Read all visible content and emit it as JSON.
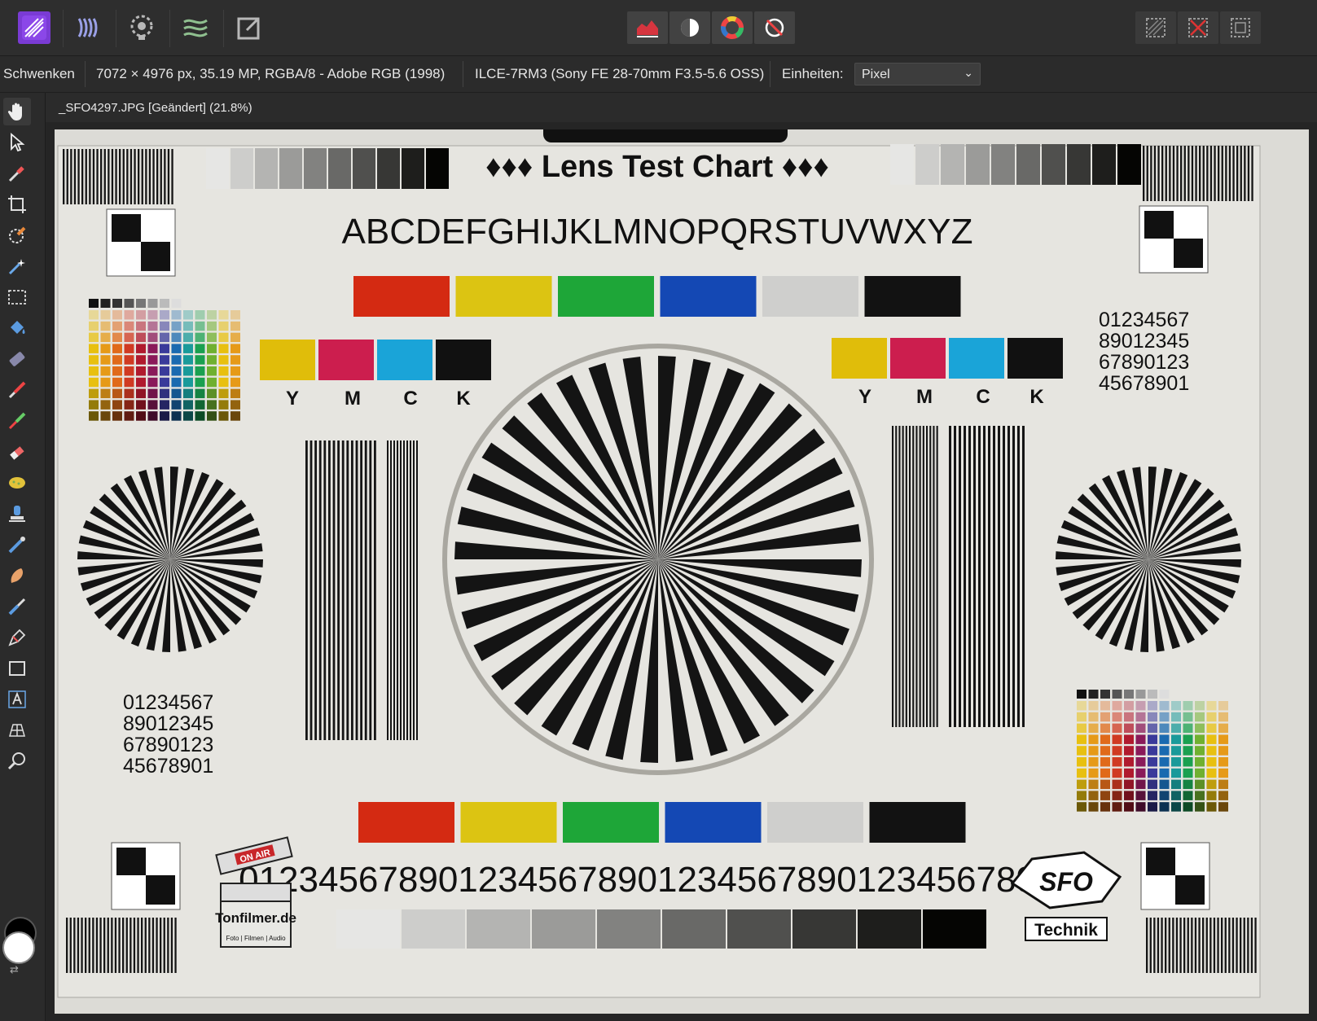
{
  "toolbar": {
    "personas": [
      "Photo Persona",
      "Liquify Persona",
      "Develop Persona",
      "Tone Mapping Persona",
      "Export Persona"
    ],
    "studio_buttons": [
      "histogram-icon",
      "adjustment-icon",
      "color-wheel-icon",
      "navigator-icon"
    ],
    "view_buttons": [
      "selection-mask-icon",
      "deselect-icon",
      "marquee-icon"
    ]
  },
  "context": {
    "tool_name": "Schwenken",
    "image_info": "7072 × 4976 px, 35.19 MP, RGBA/8 - Adobe RGB (1998)",
    "camera_info": "ILCE-7RM3 (Sony FE 28-70mm F3.5-5.6 OSS)",
    "units_label": "Einheiten:",
    "units_value": "Pixel"
  },
  "document": {
    "tab_title": "_SFO4297.JPG [Geändert] (21.8%)"
  },
  "tools": [
    "hand-icon",
    "move-icon",
    "color-picker-icon",
    "crop-icon",
    "selection-brush-icon",
    "flood-select-icon",
    "marquee-icon",
    "flood-fill-icon",
    "gradient-icon",
    "paint-brush-icon",
    "pixel-tool-icon",
    "erase-brush-icon",
    "dodge-icon",
    "clone-icon",
    "blemish-icon",
    "smudge-icon",
    "retouch-icon",
    "pen-icon",
    "rectangle-icon",
    "artistic-text-icon",
    "mesh-warp-icon",
    "zoom-icon"
  ],
  "chart": {
    "title": "♦♦♦ Lens Test Chart ♦♦♦",
    "alphabet": "ABCDEFGHIJKLMNOPQRSTUVWXYZ",
    "cmyk_labels": [
      "Y",
      "M",
      "C",
      "K"
    ],
    "number_block": [
      "01234567",
      "89012345",
      "67890123",
      "45678901"
    ],
    "bottom_numbers": "012345678901234567890123456789012345678901",
    "logo_left_top": "ON AIR",
    "logo_left_main": "Tonfilmer.de",
    "logo_left_sub": "Foto | Filmen | Audio",
    "logo_right_top": "SFO",
    "logo_right_bottom": "Technik",
    "color_bar": [
      "#d42a12",
      "#dcc412",
      "#1ea638",
      "#1448b4",
      "#cfcfcd",
      "#121212"
    ],
    "cmyk_colors": [
      "#e0bd0a",
      "#cc1e4e",
      "#1aa4d8",
      "#111111"
    ]
  }
}
